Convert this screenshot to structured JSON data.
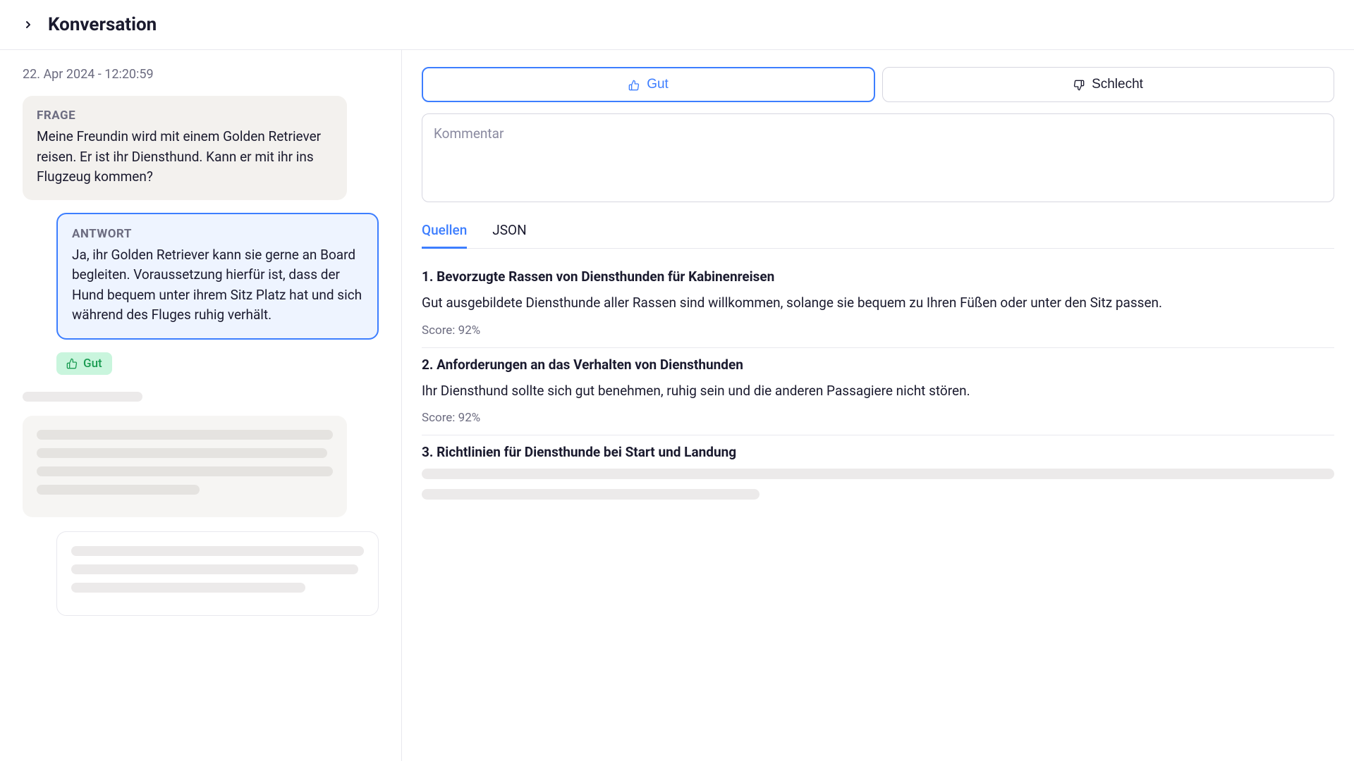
{
  "header": {
    "title": "Konversation"
  },
  "left": {
    "timestamp": "22. Apr 2024 - 12:20:59",
    "frage": {
      "label": "FRAGE",
      "text": "Meine Freundin wird mit einem Golden Retriever reisen. Er ist ihr Diensthund. Kann er mit ihr ins Flugzeug kommen?"
    },
    "antwort": {
      "label": "ANTWORT",
      "text": "Ja, ihr Golden Retriever kann sie gerne an Board begleiten. Voraussetzung hierfür ist, dass der Hund bequem unter ihrem Sitz Platz hat und sich während des Fluges ruhig verhält."
    },
    "rating": {
      "label": "Gut"
    }
  },
  "right": {
    "buttons": {
      "good": "Gut",
      "bad": "Schlecht"
    },
    "comment": {
      "placeholder": "Kommentar"
    },
    "tabs": {
      "sources": "Quellen",
      "json": "JSON"
    },
    "sources": [
      {
        "title": "1. Bevorzugte Rassen von Diensthunden für Kabinenreisen",
        "body": "Gut ausgebildete Diensthunde aller Rassen sind willkommen, solange sie bequem zu Ihren Füßen oder unter den Sitz passen.",
        "score": "Score: 92%"
      },
      {
        "title": "2. Anforderungen an das Verhalten von Diensthunden",
        "body": "Ihr Diensthund sollte sich gut benehmen, ruhig sein und die anderen Passagiere nicht stören.",
        "score": "Score: 92%"
      },
      {
        "title": "3. Richtlinien für Diensthunde bei Start und Landung",
        "body": "",
        "score": ""
      }
    ]
  }
}
